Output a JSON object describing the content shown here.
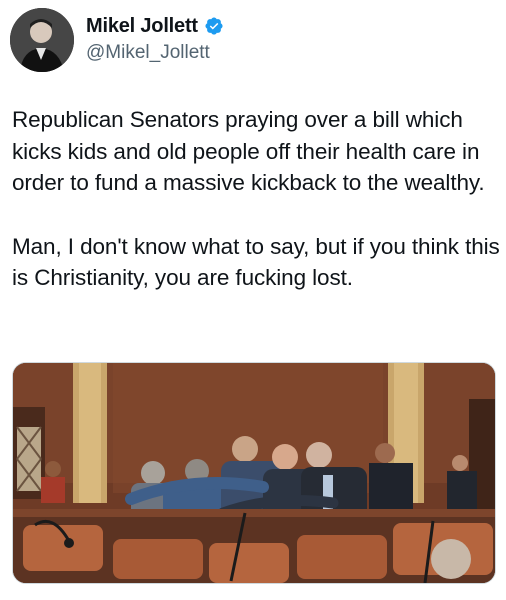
{
  "author": {
    "display_name": "Mikel Jollett",
    "handle": "@Mikel_Jollett",
    "verified_icon": "verified-badge-icon",
    "avatar": "avatar-photo"
  },
  "tweet": {
    "paragraphs": [
      "Republican Senators praying over a bill which kicks kids and old people off their health care in order to fund a massive kickback to the wealthy.",
      "Man, I don't know what to say, but if you think this is Christianity, you are fucking lost."
    ]
  },
  "media": {
    "description_icon": "senate-chamber-photo",
    "colors": {
      "wood": "#7a432b",
      "seat": "#b5653e",
      "suit_dark": "#2c3442",
      "suit_blue": "#3f5f8a"
    }
  },
  "colors": {
    "text": "#0f1419",
    "secondary": "#536471",
    "verified": "#1d9bf0"
  }
}
